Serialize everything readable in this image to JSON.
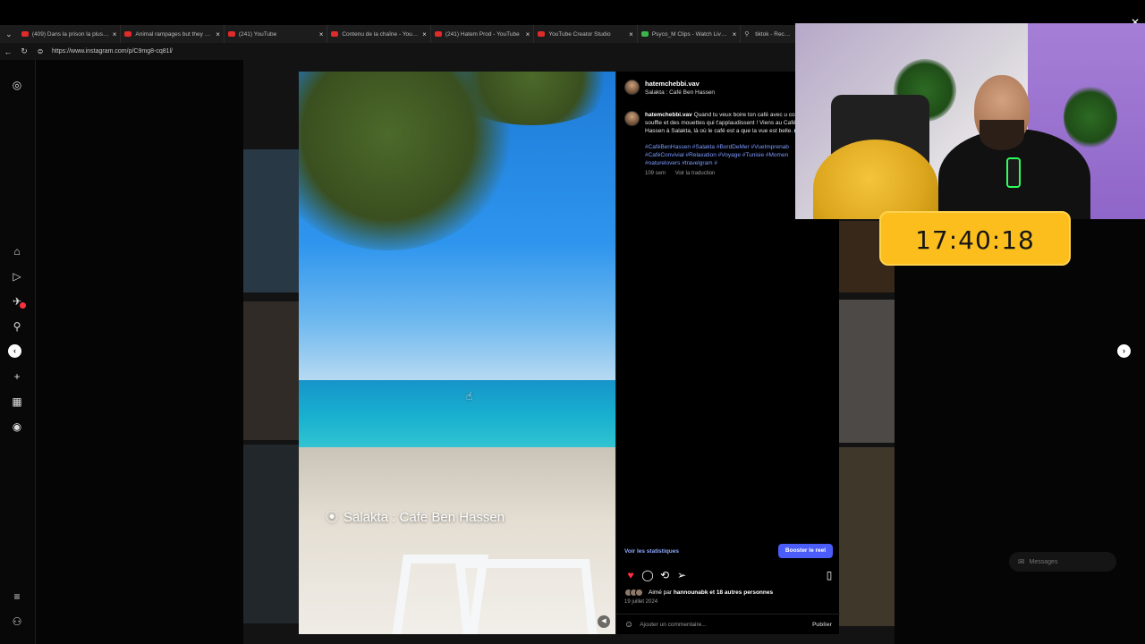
{
  "browser": {
    "tabs": [
      {
        "label": "(409) Dans la prison la plus surp",
        "icon": "youtube-icon",
        "close": "×"
      },
      {
        "label": "Animal rampages but they get w",
        "icon": "youtube-icon",
        "close": "×"
      },
      {
        "label": "(241) YouTube",
        "icon": "youtube-icon",
        "close": "×"
      },
      {
        "label": "Contenu de la chaîne - YouTube",
        "icon": "youtube-icon",
        "close": "×"
      },
      {
        "label": "(241) Hatem Prod - YouTube",
        "icon": "youtube-icon",
        "close": "×"
      },
      {
        "label": "YouTube Creator Studio",
        "icon": "youtube-icon",
        "close": "×"
      },
      {
        "label": "Psyco_M Clips - Watch Live on Ki",
        "icon": "kick-icon",
        "close": "×"
      },
      {
        "label": "tiktok - Recherche",
        "icon": "search-icon",
        "close": ""
      }
    ],
    "url": "https://www.instagram.com/p/C9mg8-cq81l/"
  },
  "post": {
    "username": "hatemchebbi.vav",
    "location": "Salakta : Café Ben Hassen",
    "caption_user": "hatemchebbi.vav",
    "caption_text": "Quand tu veux boire ton café avec u couper le souffle et des mouettes qui t'applaudissent ! Viens au Café Ben Hassen à Salakta, là où le café est a que la vue est belle. 🌊 🎯",
    "hashtags": "#CaféBenHassen #Salakta #BordDeMer #VueImprenab #CaféConvivial #Relaxation #Voyage #Tunisie #Momen #naturelovers #travelgram #",
    "time_ago": "109 sem",
    "translate": "Voir la traduction",
    "video_overlay": "Salakta : Cafe Ben Hassen",
    "stats_link": "Voir les statistiques",
    "boost_button": "Booster le reel",
    "liked_prefix": "Aimé par",
    "liked_user": "hannounabk",
    "liked_suffix": "et 18 autres personnes",
    "date": "19 juillet 2024",
    "comment_placeholder": "Ajouter un commentaire...",
    "publish": "Publier"
  },
  "messages_pill": "Messages",
  "clock": "17:40:18",
  "colors": {
    "accent": "#4a5df9",
    "like": "#ff3040",
    "clock_bg": "#fbbe1c"
  }
}
